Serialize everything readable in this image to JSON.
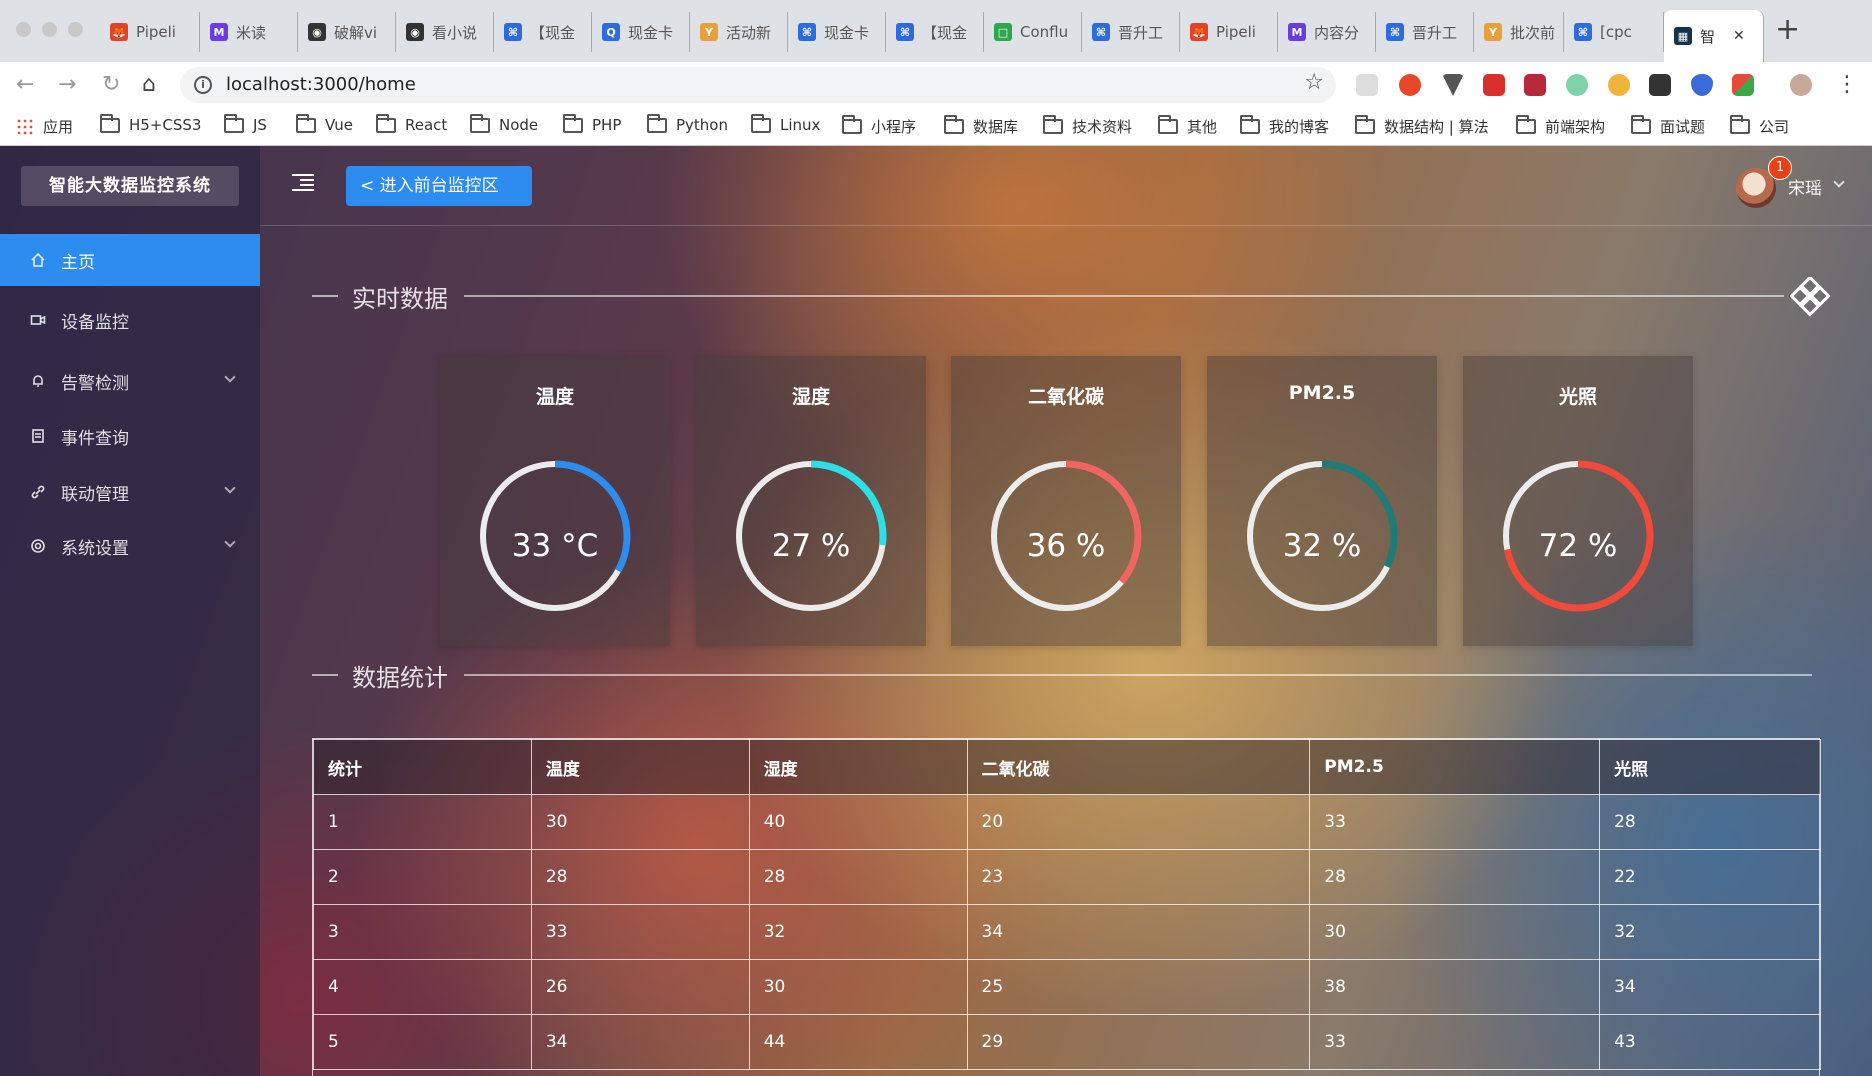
{
  "browser": {
    "tabs": [
      {
        "label": "Pipeli",
        "color": "#e24329",
        "glyph": "🦊"
      },
      {
        "label": "米读",
        "color": "#6b3ce0",
        "glyph": "M"
      },
      {
        "label": "破解vi",
        "color": "#333333",
        "glyph": "◉"
      },
      {
        "label": "看小说",
        "color": "#333333",
        "glyph": "◉"
      },
      {
        "label": "【现金",
        "color": "#2d6be0",
        "glyph": "⌘"
      },
      {
        "label": "现金卡",
        "color": "#2d6be0",
        "glyph": "Q"
      },
      {
        "label": "活动新",
        "color": "#e8a13a",
        "glyph": "Y"
      },
      {
        "label": "现金卡",
        "color": "#2d6be0",
        "glyph": "⌘"
      },
      {
        "label": "【现金",
        "color": "#2d6be0",
        "glyph": "⌘"
      },
      {
        "label": "Conflu",
        "color": "#2aa84a",
        "glyph": "□"
      },
      {
        "label": "晋升工",
        "color": "#2d6be0",
        "glyph": "⌘"
      },
      {
        "label": "Pipeli",
        "color": "#e24329",
        "glyph": "🦊"
      },
      {
        "label": "内容分",
        "color": "#6b3ce0",
        "glyph": "M"
      },
      {
        "label": "晋升工",
        "color": "#2d6be0",
        "glyph": "⌘"
      },
      {
        "label": "批次前",
        "color": "#e8a13a",
        "glyph": "Y"
      },
      {
        "label": "[cpc",
        "color": "#2d6be0",
        "glyph": "⌘"
      },
      {
        "label": "智",
        "color": "#18324a",
        "glyph": "▦",
        "active": true
      }
    ],
    "url": "localhost:3000/home",
    "bookmarks": [
      "应用",
      "H5+CSS3",
      "JS",
      "Vue",
      "React",
      "Node",
      "PHP",
      "Python",
      "Linux",
      "小程序",
      "数据库",
      "技术资料",
      "其他",
      "我的博客",
      "数据结构 | 算法",
      "前端架构",
      "面试题",
      "公司"
    ]
  },
  "app": {
    "logo": "智能大数据监控系统",
    "menu": [
      {
        "label": "主页",
        "icon": "home-icon",
        "active": true,
        "expandable": false
      },
      {
        "label": "设备监控",
        "icon": "video-camera-icon",
        "active": false,
        "expandable": false
      },
      {
        "label": "告警检测",
        "icon": "bell-icon",
        "active": false,
        "expandable": true
      },
      {
        "label": "事件查询",
        "icon": "document-icon",
        "active": false,
        "expandable": false
      },
      {
        "label": "联动管理",
        "icon": "link-icon",
        "active": false,
        "expandable": true
      },
      {
        "label": "系统设置",
        "icon": "gear-icon",
        "active": false,
        "expandable": true
      }
    ],
    "header": {
      "front_button": "进入前台监控区",
      "username": "宋瑶",
      "badge": "1"
    },
    "realtime_title": "实时数据",
    "stats_title": "数据统计",
    "gauges": [
      {
        "title": "温度",
        "value": 33,
        "unit": "°C",
        "color": "#2d8cf0"
      },
      {
        "title": "湿度",
        "value": 27,
        "unit": "%",
        "color": "#2de0e8"
      },
      {
        "title": "二氧化碳",
        "value": 36,
        "unit": "%",
        "color": "#f06464"
      },
      {
        "title": "PM2.5",
        "value": 32,
        "unit": "%",
        "color": "#1f7a78"
      },
      {
        "title": "光照",
        "value": 72,
        "unit": "%",
        "color": "#f04a3a"
      }
    ],
    "table": {
      "headers": [
        "统计",
        "温度",
        "湿度",
        "二氧化碳",
        "PM2.5",
        "光照"
      ],
      "rows": [
        [
          "1",
          "30",
          "40",
          "20",
          "33",
          "28"
        ],
        [
          "2",
          "28",
          "28",
          "23",
          "28",
          "22"
        ],
        [
          "3",
          "33",
          "32",
          "34",
          "30",
          "32"
        ],
        [
          "4",
          "26",
          "30",
          "25",
          "38",
          "34"
        ],
        [
          "5",
          "34",
          "44",
          "29",
          "33",
          "43"
        ]
      ]
    }
  }
}
